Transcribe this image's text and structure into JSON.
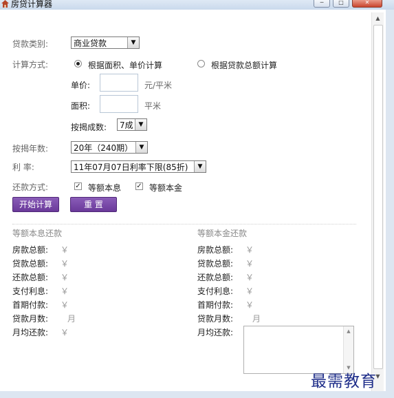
{
  "window": {
    "title": "房贷计算器",
    "minimize_glyph": "─",
    "maximize_glyph": "□",
    "close_glyph": "✕"
  },
  "scrollbar": {
    "up_glyph": "▲",
    "down_glyph": "▼"
  },
  "form": {
    "loan_type_label": "贷款类别:",
    "loan_type_value": "商业贷款",
    "calc_method_label": "计算方式:",
    "method_area_label": "根据面积、单价计算",
    "method_total_label": "根据贷款总额计算",
    "unit_price_label": "单价:",
    "unit_price_unit": "元/平米",
    "area_label": "面积:",
    "area_unit": "平米",
    "mortgage_ratio_label": "按揭成数:",
    "mortgage_ratio_value": "7成",
    "years_label": "按揭年数:",
    "years_value": "20年（240期）",
    "rate_label": "利 率:",
    "rate_value": "11年07月07日利率下限(85折)",
    "repay_label": "还款方式:",
    "repay_option_1": "等额本息",
    "repay_option_2": "等额本金",
    "dropdown_glyph": "▼",
    "check_glyph": "✓"
  },
  "buttons": {
    "calculate": "开始计算",
    "reset": "重 置"
  },
  "results": {
    "left_title": "等额本息还款",
    "right_title": "等额本金还款",
    "house_total": "房款总额:",
    "loan_total": "贷款总额:",
    "repay_total": "还款总额:",
    "interest": "支付利息:",
    "down_payment": "首期付款:",
    "loan_months": "贷款月数:",
    "monthly_repay": "月均还款:",
    "currency": "￥",
    "month_unit": "月"
  },
  "watermark": "最需教育"
}
